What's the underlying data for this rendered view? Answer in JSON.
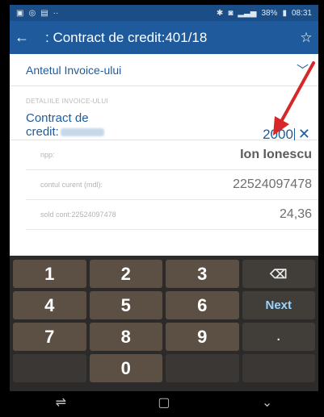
{
  "status_bar": {
    "left_icons": [
      "gallery-icon",
      "wifi-icon",
      "photo-icon"
    ],
    "battery": "38%",
    "time": "08:31"
  },
  "app_bar": {
    "title": ": Contract de credit:401/18"
  },
  "invoice_header": {
    "label": "Antetul Invoice-ului"
  },
  "section": {
    "title": "DETALIILE INVOICE-ULUI"
  },
  "credit_field": {
    "label_line1": "Contract de",
    "label_line2": "credit:",
    "value": "2000"
  },
  "details": [
    {
      "key": "npp:",
      "value": "Ion Ionescu"
    },
    {
      "key": "contul curent (mdl):",
      "value": "22524097478"
    },
    {
      "key": "sold cont:22524097478",
      "value": "24,36"
    }
  ],
  "keyboard": {
    "row1": [
      "1",
      "2",
      "3"
    ],
    "row2": [
      "4",
      "5",
      "6"
    ],
    "next_label": "Next",
    "row3": [
      "7",
      "8",
      "9"
    ],
    "dot_label": ".",
    "row4": [
      "0"
    ]
  },
  "colors": {
    "app_bar": "#1f5b9c",
    "accent_text": "#1f5b9c",
    "annotation_arrow": "#d62828",
    "keyboard_key": "#5b5043"
  }
}
